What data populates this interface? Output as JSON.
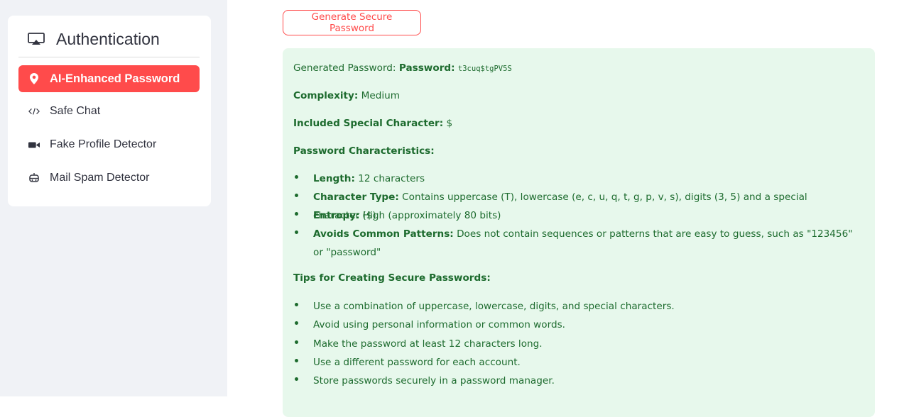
{
  "sidebar": {
    "title": "Authentication",
    "items": [
      {
        "label": "AI-Enhanced Password",
        "icon": "location-pin-icon",
        "active": true
      },
      {
        "label": "Safe Chat",
        "icon": "code-icon",
        "active": false
      },
      {
        "label": "Fake Profile Detector",
        "icon": "video-camera-icon",
        "active": false
      },
      {
        "label": "Mail Spam Detector",
        "icon": "robot-icon",
        "active": false
      }
    ]
  },
  "main": {
    "generate_button": "Generate Secure Password",
    "result": {
      "generated_prefix": "Generated Password: ",
      "password_label": "Password:",
      "password_value": "t3cuq$tgPV5S",
      "complexity_label": "Complexity:",
      "complexity_value": " Medium",
      "special_label": "Included Special Character:",
      "special_value": " $",
      "characteristics_heading": "Password Characteristics:",
      "characteristics": [
        {
          "label": "Length:",
          "text": " 12 characters"
        },
        {
          "label": "Character Type:",
          "text": " Contains uppercase (T), lowercase (e, c, u, q, t, g, p, v, s), digits (3, 5) and a special character ($)"
        },
        {
          "label": "Entropy:",
          "text": " High (approximately 80 bits)"
        },
        {
          "label": "Avoids Common Patterns:",
          "text": " Does not contain sequences or patterns that are easy to guess, such as \"123456\" or \"password\""
        }
      ],
      "tips_heading": "Tips for Creating Secure Passwords:",
      "tips": [
        "Use a combination of uppercase, lowercase, digits, and special characters.",
        "Avoid using personal information or common words.",
        "Make the password at least 12 characters long.",
        "Use a different password for each account.",
        "Store passwords securely in a password manager."
      ]
    }
  },
  "colors": {
    "accent": "#ff4b4b",
    "sidebar_bg": "#f0f2f6",
    "success_bg": "#e7f8ec",
    "success_text": "#1d6b2e"
  }
}
